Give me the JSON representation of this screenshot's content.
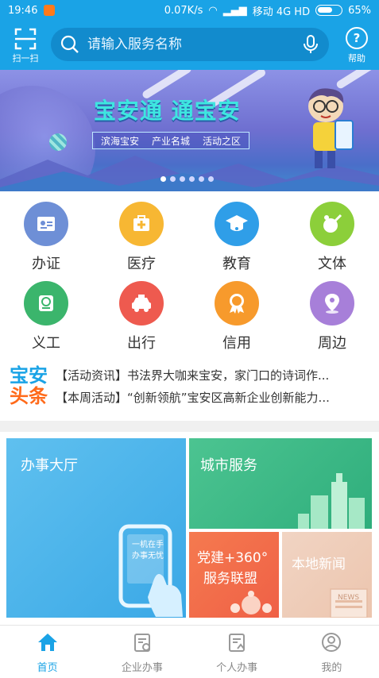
{
  "status_bar": {
    "time": "19:46",
    "network_speed": "0.07K/s",
    "carrier": "移动 4G HD",
    "battery": "65%",
    "battery_level": 0.65
  },
  "header": {
    "scan_label": "扫一扫",
    "search_placeholder": "请输入服务名称",
    "help_label": "帮助"
  },
  "banner": {
    "title": "宝安通 通宝安",
    "tags": [
      "滨海宝安",
      "产业名城",
      "活动之区"
    ],
    "page_count": 6,
    "active_index": 0
  },
  "services": [
    {
      "label": "办证",
      "icon": "id-card-icon",
      "color": "#6e8fd6"
    },
    {
      "label": "医疗",
      "icon": "medical-kit-icon",
      "color": "#f7b733"
    },
    {
      "label": "教育",
      "icon": "graduation-cap-icon",
      "color": "#2f9ee8"
    },
    {
      "label": "文体",
      "icon": "ping-pong-icon",
      "color": "#8ccf3a"
    },
    {
      "label": "义工",
      "icon": "volunteer-badge-icon",
      "color": "#3bb56c"
    },
    {
      "label": "出行",
      "icon": "taxi-icon",
      "color": "#ee5a4f"
    },
    {
      "label": "信用",
      "icon": "credit-medal-icon",
      "color": "#f79a2c"
    },
    {
      "label": "周边",
      "icon": "location-pin-icon",
      "color": "#a77fd9"
    }
  ],
  "headlines": {
    "logo_line1": "宝安",
    "logo_line2": "头条",
    "items": [
      {
        "tag": "【活动资讯】",
        "text": "书法界大咖来宝安，家门口的诗词作..."
      },
      {
        "tag": "【本周活动】",
        "text": "“创新领航”宝安区高新企业创新能力..."
      }
    ]
  },
  "tiles": {
    "hall": {
      "title": "办事大厅",
      "phone_text": "一机在手 办事无忧"
    },
    "city": {
      "title": "城市服务"
    },
    "party": {
      "title_line1": "党建+360°",
      "title_line2": "服务联盟"
    },
    "local": {
      "title": "本地新闻",
      "badge": "NEWS"
    }
  },
  "tabbar": {
    "items": [
      {
        "label": "首页",
        "icon": "home-icon",
        "active": true
      },
      {
        "label": "企业办事",
        "icon": "enterprise-doc-icon",
        "active": false
      },
      {
        "label": "个人办事",
        "icon": "personal-doc-icon",
        "active": false
      },
      {
        "label": "我的",
        "icon": "user-icon",
        "active": false
      }
    ]
  },
  "colors": {
    "primary": "#1aa3e6",
    "accent_orange": "#ff6a1a"
  }
}
